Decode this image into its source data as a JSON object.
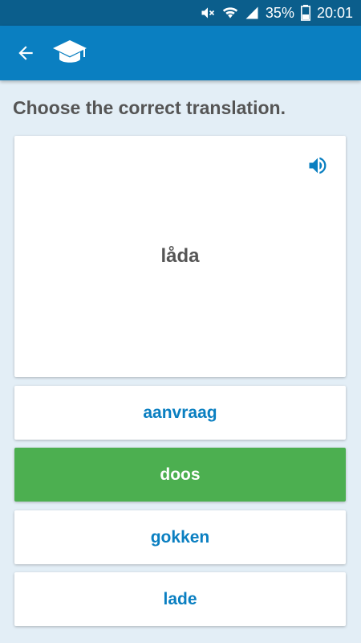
{
  "status_bar": {
    "battery": "35%",
    "time": "20:01",
    "icons": [
      "mute-icon",
      "wifi-icon",
      "signal-icon",
      "battery-icon"
    ]
  },
  "app_bar": {
    "back_icon": "arrow-back-icon",
    "logo_icon": "graduation-cap-icon"
  },
  "quiz": {
    "prompt": "Choose the correct translation.",
    "word": "låda",
    "speaker_icon": "speaker-icon",
    "options": [
      {
        "label": "aanvraag",
        "selected": false
      },
      {
        "label": "doos",
        "selected": true
      },
      {
        "label": "gokken",
        "selected": false
      },
      {
        "label": "lade",
        "selected": false
      }
    ]
  },
  "colors": {
    "status_bar": "#0b5e8c",
    "app_bar": "#0a7fc1",
    "background": "#e3eef6",
    "accent_text": "#0a7fc1",
    "selected_option": "#4caf50"
  }
}
